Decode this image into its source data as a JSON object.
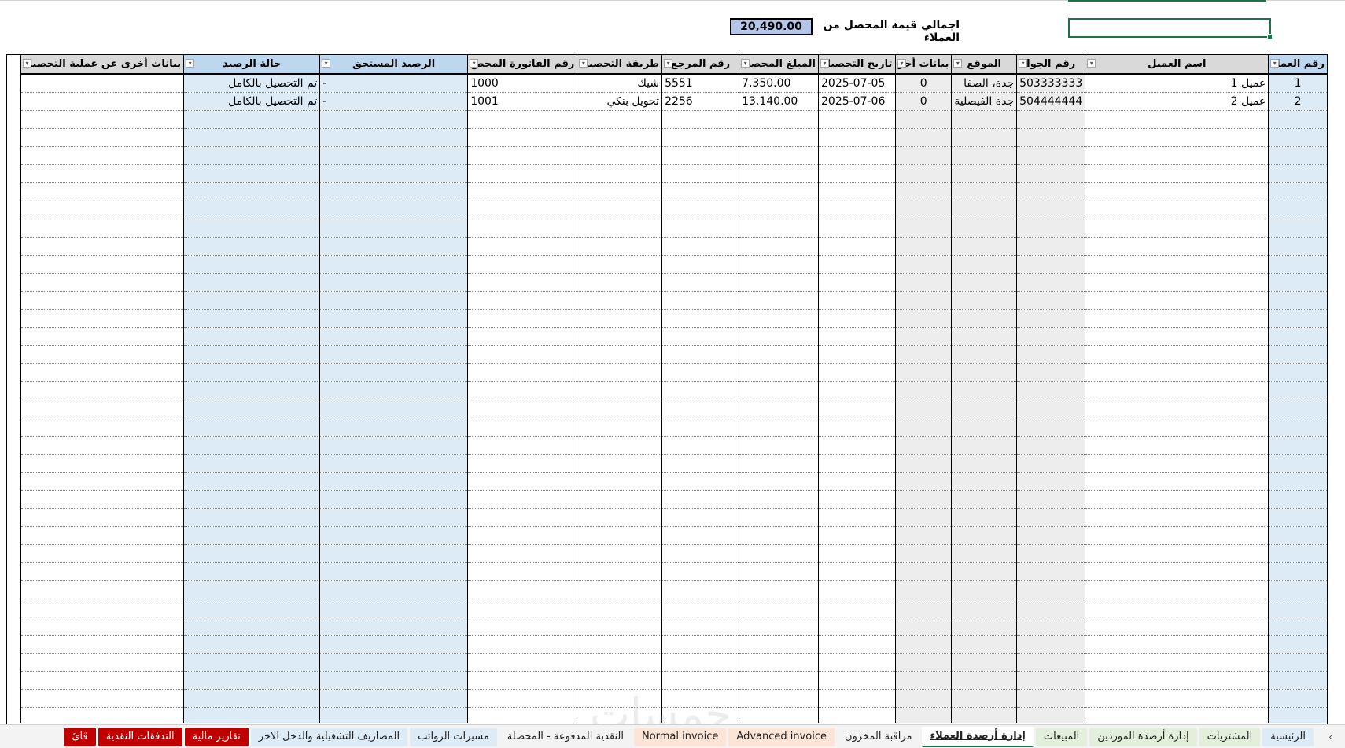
{
  "summary": {
    "label": "اجمالي قيمة المحصل من العملاء",
    "value": "20,490.00"
  },
  "columns": [
    {
      "label": "رقم العمل",
      "fill": "blue",
      "filter": true
    },
    {
      "label": "اسم العميل",
      "fill": "none",
      "filter": true
    },
    {
      "label": "رقم الجوا",
      "fill": "gray",
      "filter": true
    },
    {
      "label": "الموقع",
      "fill": "gray",
      "filter": true
    },
    {
      "label": "بيانات أخر",
      "fill": "gray",
      "filter": true
    },
    {
      "label": "تاريخ التحصيل",
      "fill": "none",
      "filter": true
    },
    {
      "label": "المبلغ المحصل",
      "fill": "none",
      "filter": true
    },
    {
      "label": "رقم المرجع",
      "fill": "none",
      "filter": true
    },
    {
      "label": "طريقة التحصيل",
      "fill": "none",
      "filter": true
    },
    {
      "label": "رقم الفاتورة المحص",
      "fill": "none",
      "filter": true
    },
    {
      "label": "الرصيد المستحق",
      "fill": "blue",
      "filter": true
    },
    {
      "label": "حالة الرصيد",
      "fill": "blue",
      "filter": true
    },
    {
      "label": "بيانات أخرى عن عملية التحصيل",
      "fill": "none",
      "filter": true
    }
  ],
  "rows": [
    [
      "1",
      "عميل 1",
      "503333333",
      "جدة، الصفا",
      "0",
      "2025-07-05",
      "7,350.00",
      "5551",
      "شيك",
      "1000",
      "-",
      "تم التحصيل بالكامل",
      ""
    ],
    [
      "2",
      "عميل 2",
      "504444444",
      "جدة الفيصلية",
      "0",
      "2025-07-06",
      "13,140.00",
      "2256",
      "تحويل بنكي",
      "1001",
      "-",
      "تم التحصيل بالكامل",
      ""
    ]
  ],
  "empty_rows": 34,
  "sheet_tabs": [
    {
      "label": "الرئيسية",
      "color": "#ddebf7"
    },
    {
      "label": "المشتريات",
      "color": "#e2efda"
    },
    {
      "label": "إدارة أرصدة الموردين",
      "color": "#e2efda"
    },
    {
      "label": "المبيعات",
      "color": "#e2efda"
    },
    {
      "label": "إدارة أرصدة العملاء",
      "color": "#ffffff",
      "active": true
    },
    {
      "label": "مراقبة المخزون",
      "color": "#f3f3f3"
    },
    {
      "label": "Advanced invoice",
      "color": "#fce4d6"
    },
    {
      "label": "Normal invoice",
      "color": "#fce4d6"
    },
    {
      "label": "النقدية المدفوعة - المحصلة",
      "color": "#f3f3f3"
    },
    {
      "label": "مسيرات الرواتب",
      "color": "#ddebf7"
    },
    {
      "label": "المصاريف التشغيلية والدخل الاخر",
      "color": "#ddebf7"
    },
    {
      "label": "تقارير مالية",
      "color": "#c00000",
      "text_color": "#ffffff"
    },
    {
      "label": "التدفقات النقدية",
      "color": "#c00000",
      "text_color": "#ffffff"
    },
    {
      "label": "قائ",
      "color": "#c00000",
      "text_color": "#ffffff"
    }
  ],
  "icons": {
    "filter": "dropdown-arrow-icon",
    "nav_prev": "chevron-left-icon",
    "nav_next": "chevron-right-icon"
  },
  "nav": {
    "next": "›",
    "prev": "‹"
  },
  "watermark": "خمسات"
}
